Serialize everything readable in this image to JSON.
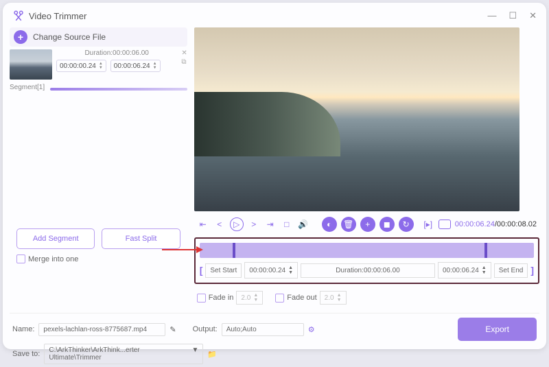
{
  "app": {
    "title": "Video Trimmer"
  },
  "source": {
    "changeLabel": "Change Source File"
  },
  "segment": {
    "durationLabel": "Duration:00:00:06.00",
    "start": "00:00:00.24",
    "end": "00:00:06.24",
    "label": "Segment[1]"
  },
  "player": {
    "current": "00:00:06.24",
    "total": "/00:00:08.02"
  },
  "trim": {
    "setStart": "Set Start",
    "startTime": "00:00:00.24",
    "durationLabel": "Duration:00:00:06.00",
    "endTime": "00:00:06.24",
    "setEnd": "Set End"
  },
  "actions": {
    "addSegment": "Add Segment",
    "fastSplit": "Fast Split",
    "merge": "Merge into one"
  },
  "fade": {
    "inLabel": "Fade in",
    "inVal": "2.0",
    "outLabel": "Fade out",
    "outVal": "2.0"
  },
  "footer": {
    "nameLabel": "Name:",
    "nameVal": "pexels-lachlan-ross-8775687.mp4",
    "outputLabel": "Output:",
    "outputVal": "Auto;Auto",
    "saveLabel": "Save to:",
    "savePath": "C:\\ArkThinker\\ArkThink...erter Ultimate\\Trimmer",
    "export": "Export"
  }
}
